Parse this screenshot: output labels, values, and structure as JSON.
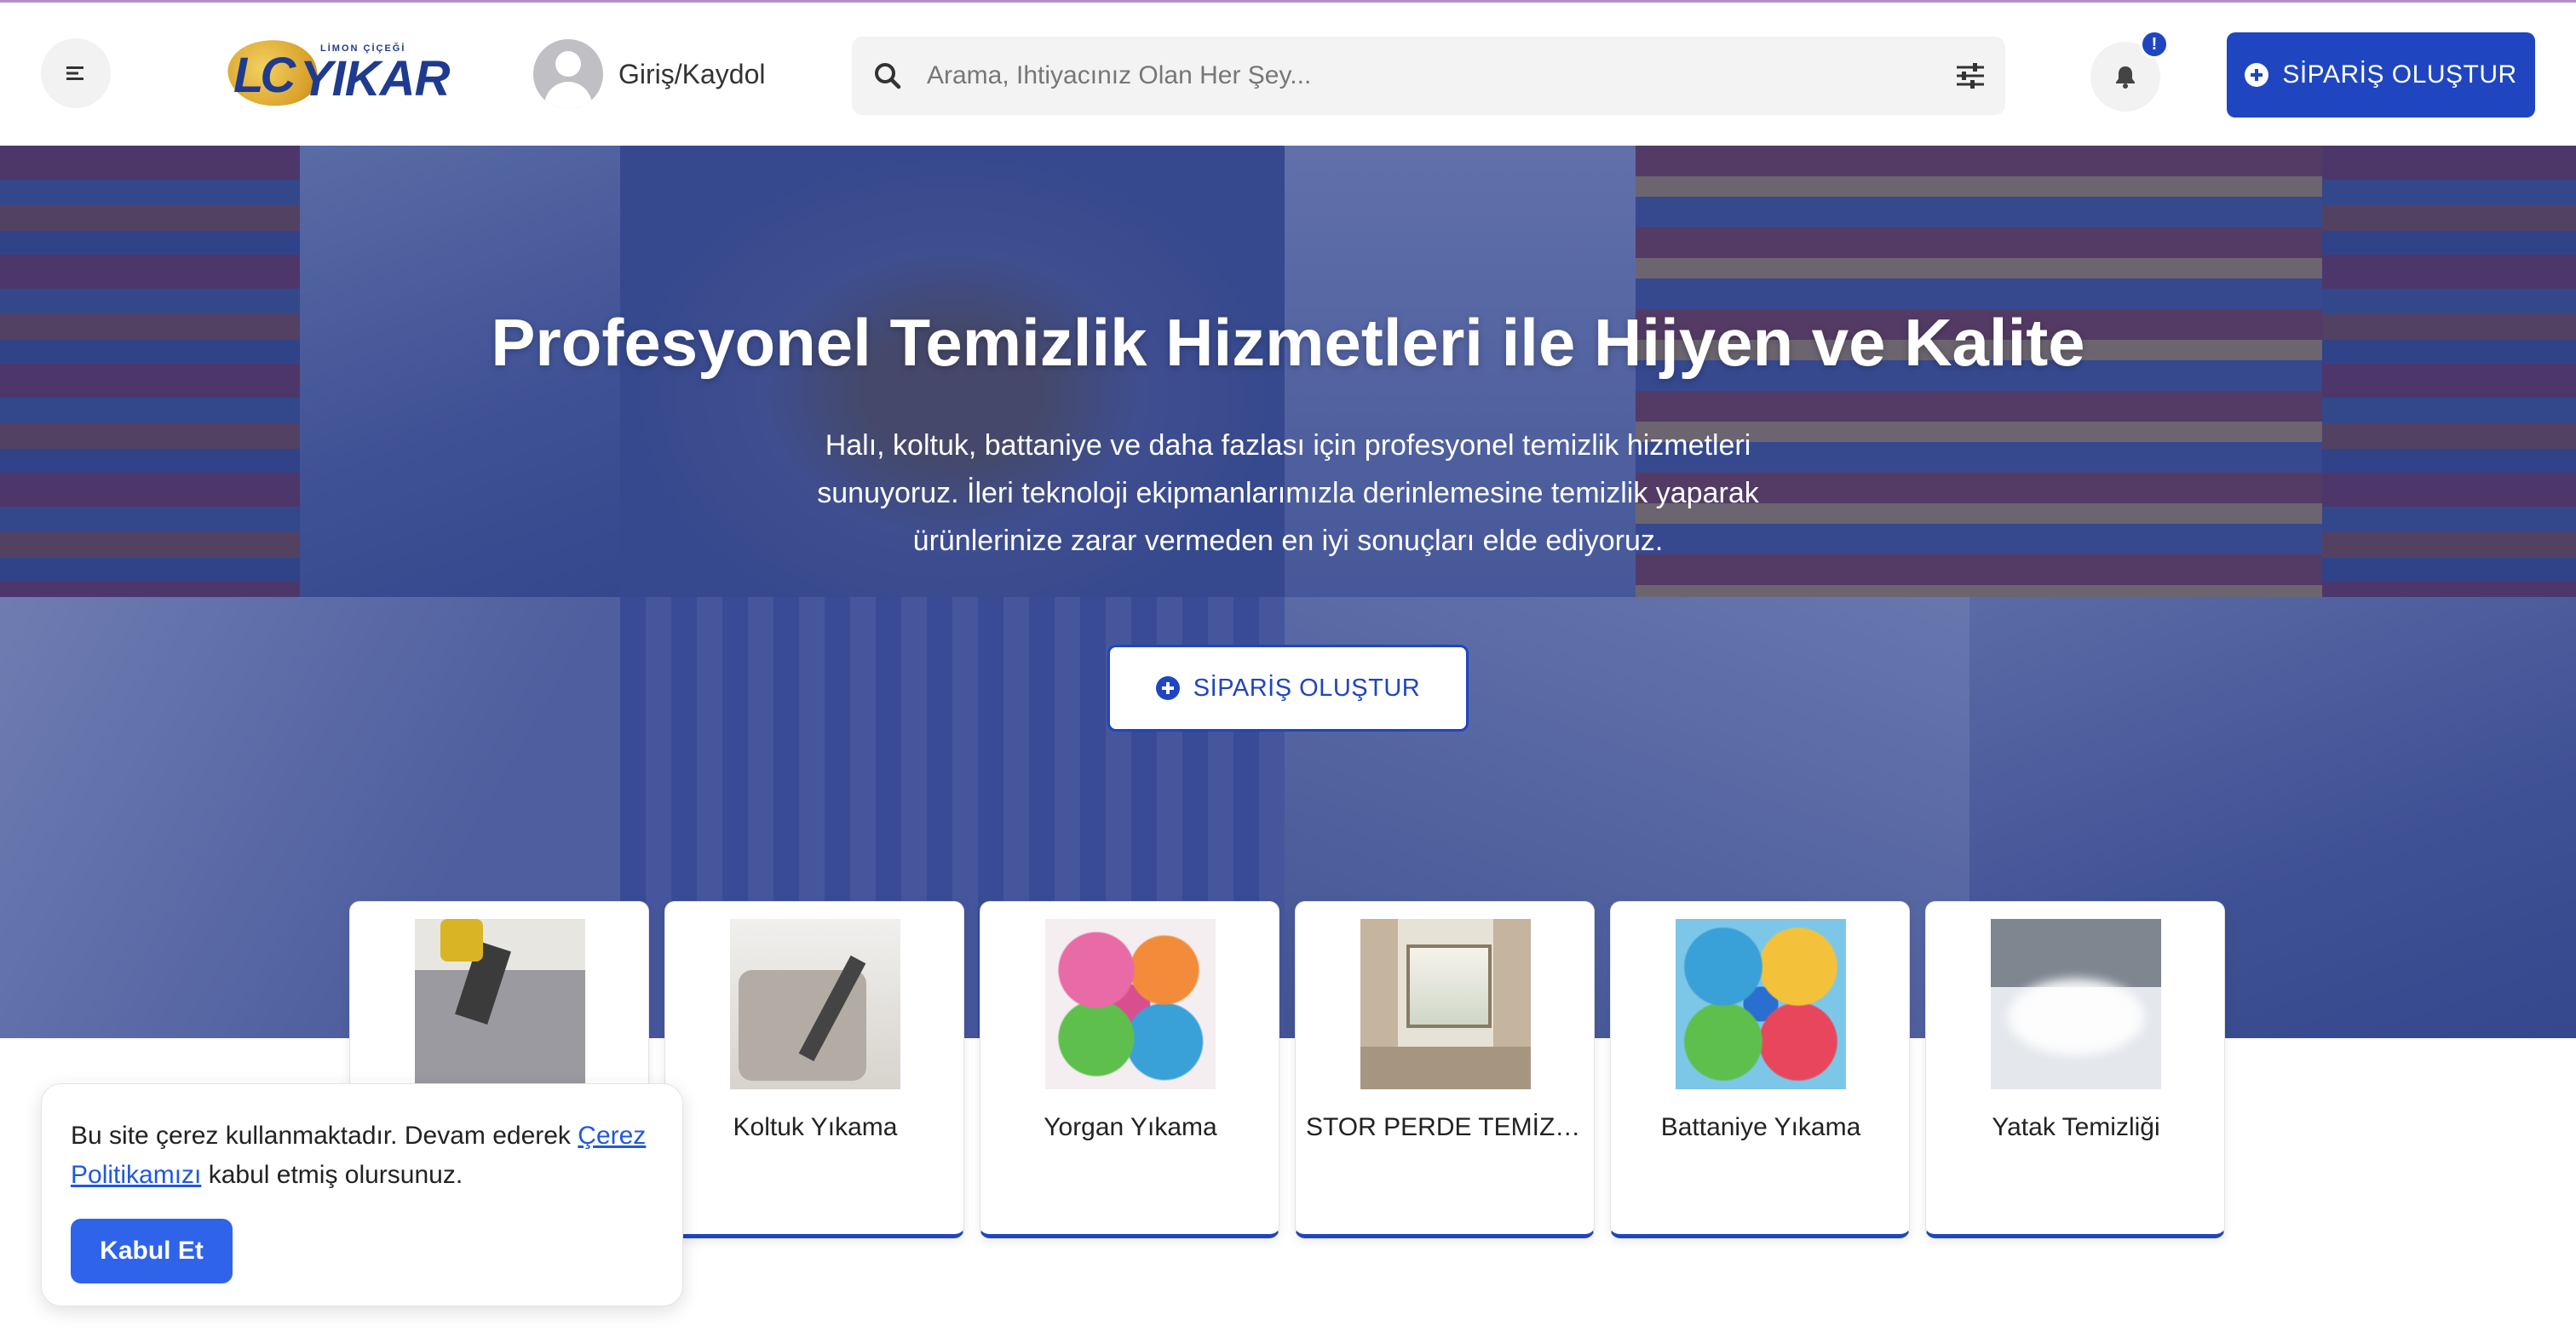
{
  "header": {
    "menu_icon": "menu-align-left-icon",
    "logo": {
      "tagline": "LİMON ÇİÇEĞİ",
      "mark": "LC",
      "wordmark": "YIKAR"
    },
    "login_label": "Giriş/Kaydol",
    "search": {
      "placeholder": "Arama, Ihtiyacınız Olan Her Şey...",
      "value": ""
    },
    "notification_badge": "!",
    "order_button_label": "SİPARİŞ OLUŞTUR"
  },
  "hero": {
    "title": "Profesyonel Temizlik Hizmetleri ile Hijyen ve Kalite",
    "subtitle": "Halı, koltuk, battaniye ve daha fazlası için profesyonel temizlik hizmetleri sunuyoruz. İleri teknoloji ekipmanlarımızla derinlemesine temizlik yaparak ürünlerinize zarar vermeden en iyi sonuçları elde ediyoruz.",
    "button_label": "SİPARİŞ OLUŞTUR"
  },
  "services": [
    {
      "label": ""
    },
    {
      "label": "Koltuk Yıkama"
    },
    {
      "label": "Yorgan Yıkama"
    },
    {
      "label": "STOR PERDE TEMİZL..."
    },
    {
      "label": "Battaniye Yıkama"
    },
    {
      "label": "Yatak Temizliği"
    }
  ],
  "cookie": {
    "text_before": "Bu site çerez kullanmaktadır. Devam ederek ",
    "link_text": "Çerez Politikamızı",
    "text_after": " kabul etmiş olursunuz.",
    "accept_label": "Kabul Et"
  },
  "colors": {
    "primary": "#1f45c0",
    "accept": "#2f64ea",
    "hero_overlay": "#263a8c"
  }
}
